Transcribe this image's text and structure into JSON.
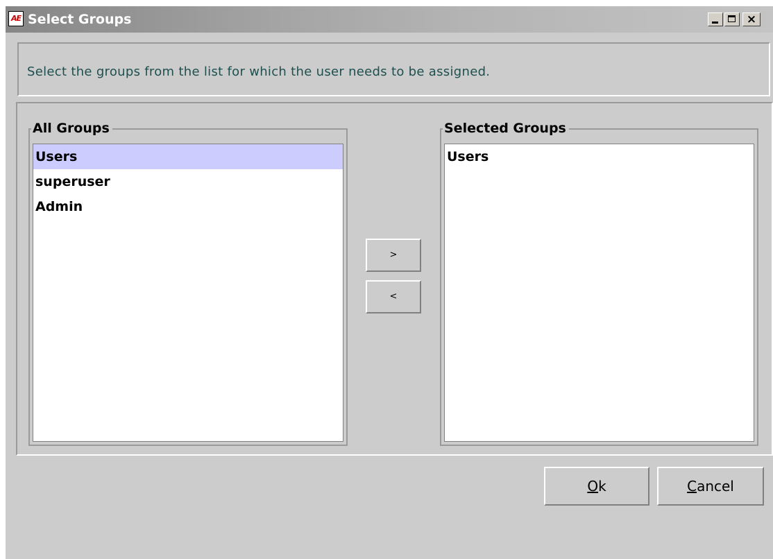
{
  "window": {
    "title": "Select Groups",
    "app_icon_text": "AE",
    "controls": {
      "minimize": "minimize",
      "maximize": "maximize",
      "close": "×"
    }
  },
  "instruction": "Select the groups from the list for which the user needs to be assigned.",
  "all_groups": {
    "label": "All Groups",
    "items": [
      "Users",
      "superuser",
      "Admin"
    ],
    "selected_index": 0
  },
  "selected_groups": {
    "label": "Selected Groups",
    "items": [
      "Users"
    ]
  },
  "buttons": {
    "add": ">",
    "remove": "<",
    "ok_mnemonic": "O",
    "ok_rest": "k",
    "cancel_mnemonic": "C",
    "cancel_rest": "ancel"
  },
  "colors": {
    "window_bg": "#cccccc",
    "selection_bg": "#ccccff",
    "instruction_text": "#1e4f4f"
  }
}
